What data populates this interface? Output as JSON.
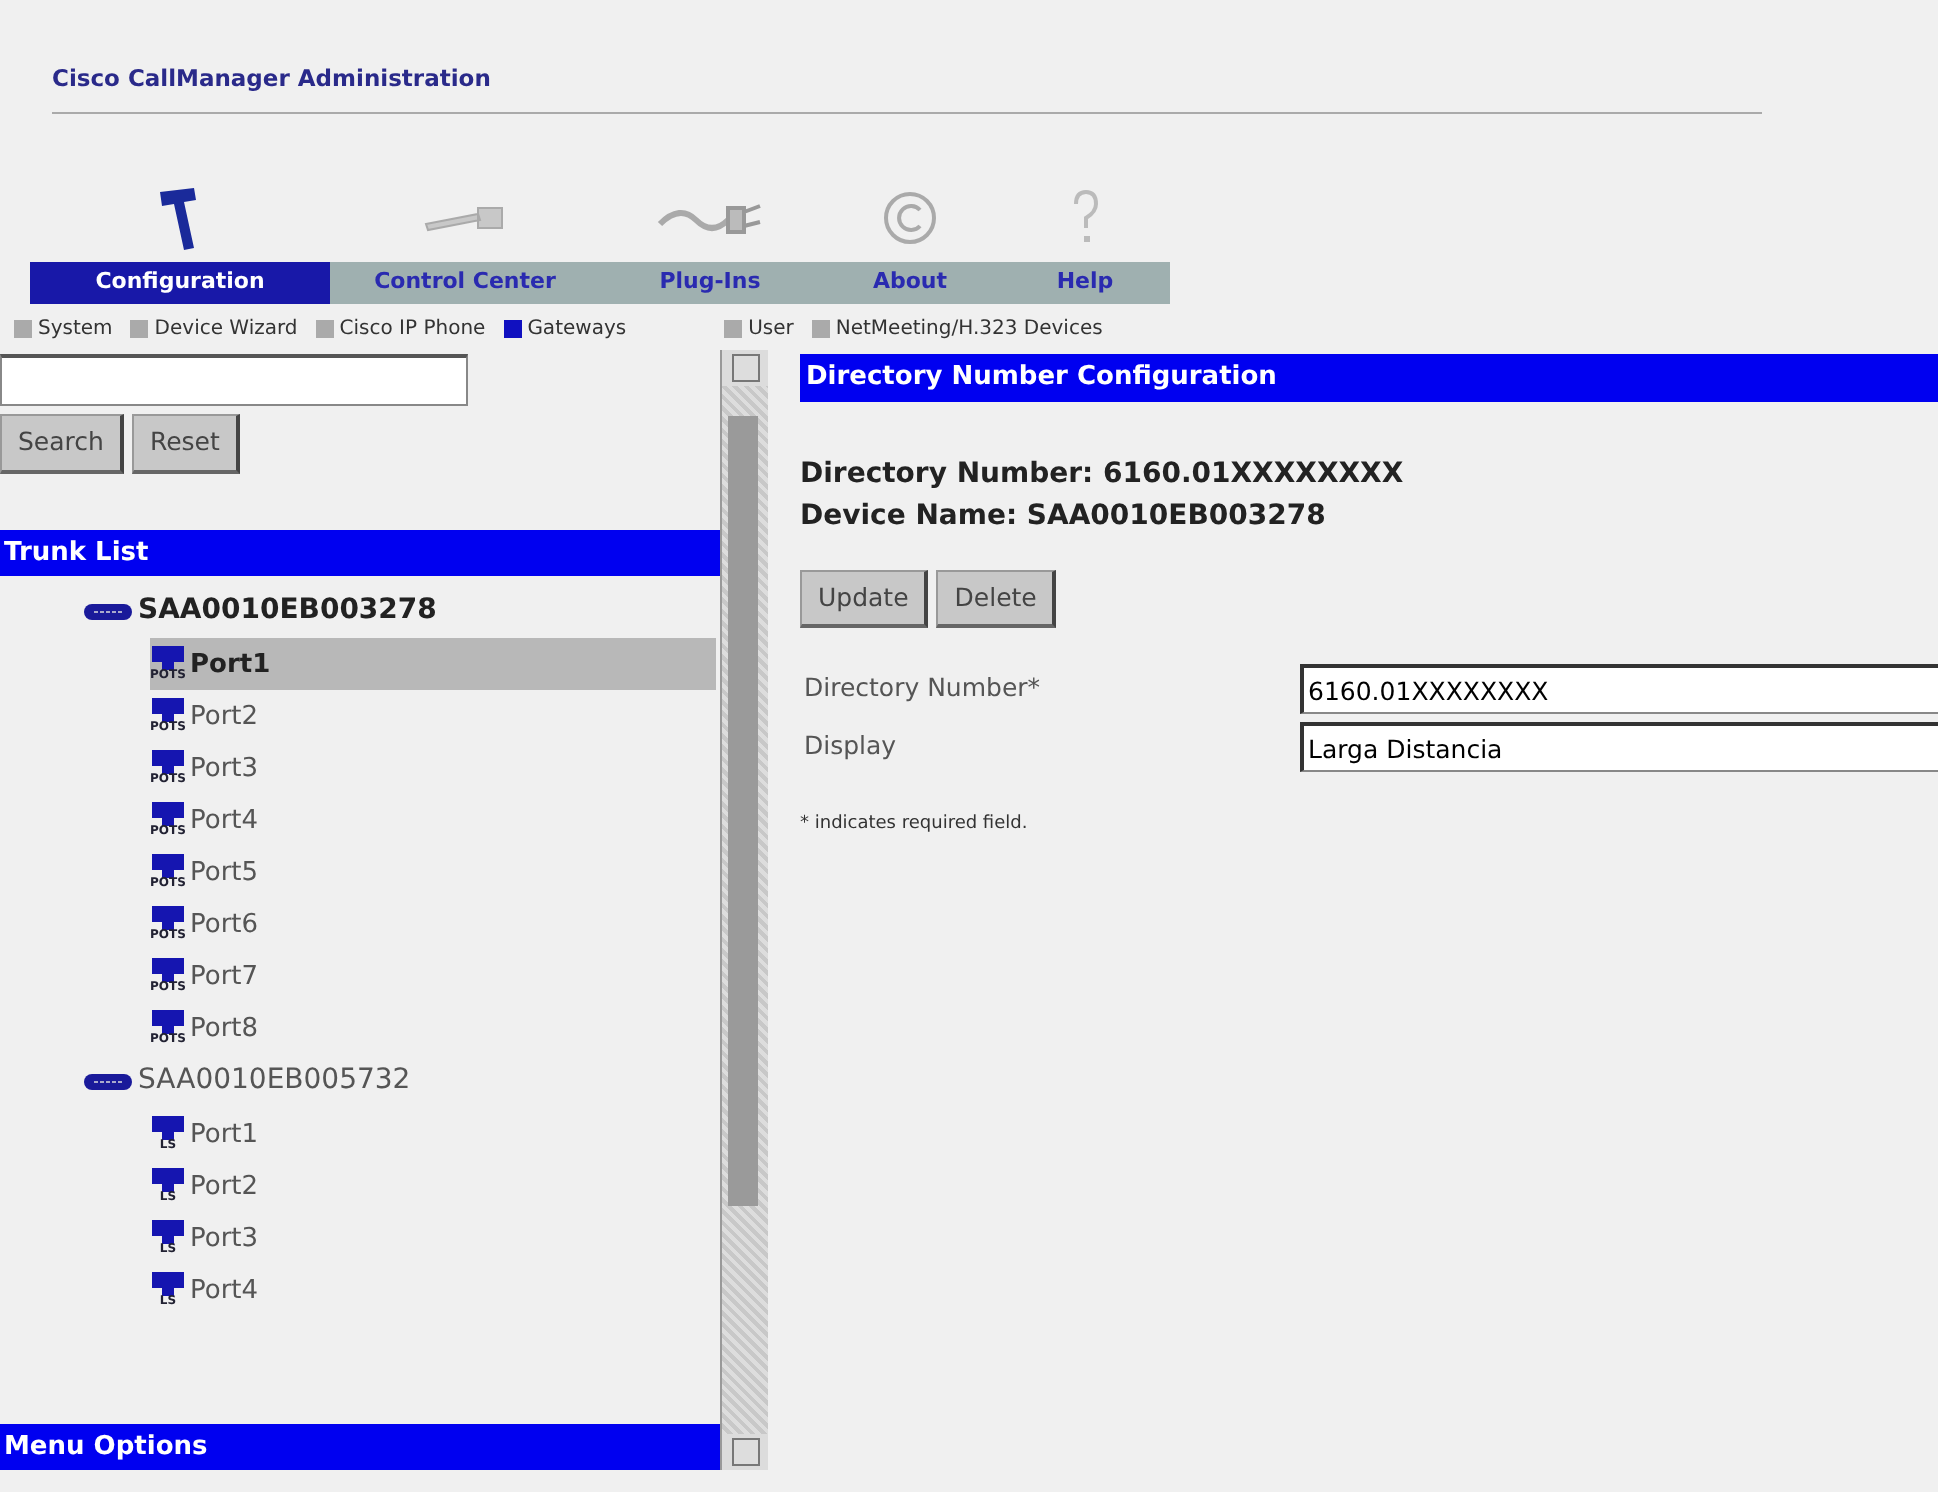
{
  "header": {
    "title": "Cisco CallManager Administration"
  },
  "tabs": [
    {
      "label": "Configuration",
      "selected": true
    },
    {
      "label": "Control Center",
      "selected": false
    },
    {
      "label": "Plug-Ins",
      "selected": false
    },
    {
      "label": "About",
      "selected": false
    },
    {
      "label": "Help",
      "selected": false
    }
  ],
  "submenu": [
    {
      "label": "System",
      "selected": false
    },
    {
      "label": "Device Wizard",
      "selected": false
    },
    {
      "label": "Cisco IP Phone",
      "selected": false
    },
    {
      "label": "Gateways",
      "selected": true
    },
    {
      "label": "User",
      "selected": false
    },
    {
      "label": "NetMeeting/H.323 Devices",
      "selected": false
    }
  ],
  "sidebar": {
    "search_buttons": [
      "Search",
      "Reset"
    ],
    "trunk_list_title": "Trunk List",
    "trunks": [
      {
        "label": "SAA0010EB003278",
        "children": [
          {
            "label": "Port1",
            "icon_label": "POTS",
            "selected": true
          },
          {
            "label": "Port2",
            "icon_label": "POTS",
            "selected": false
          },
          {
            "label": "Port3",
            "icon_label": "POTS",
            "selected": false
          },
          {
            "label": "Port4",
            "icon_label": "POTS",
            "selected": false
          },
          {
            "label": "Port5",
            "icon_label": "POTS",
            "selected": false
          },
          {
            "label": "Port6",
            "icon_label": "POTS",
            "selected": false
          },
          {
            "label": "Port7",
            "icon_label": "POTS",
            "selected": false
          },
          {
            "label": "Port8",
            "icon_label": "POTS",
            "selected": false
          }
        ]
      },
      {
        "label": "SAA0010EB005732",
        "children": [
          {
            "label": "Port1",
            "icon_label": "LS",
            "selected": false
          },
          {
            "label": "Port2",
            "icon_label": "LS",
            "selected": false
          },
          {
            "label": "Port3",
            "icon_label": "LS",
            "selected": false
          },
          {
            "label": "Port4",
            "icon_label": "LS",
            "selected": false
          }
        ]
      }
    ],
    "menu_options_title": "Menu Options"
  },
  "content": {
    "title": "Directory Number Configuration",
    "info": [
      "Directory Number: 6160.01XXXXXXXX",
      "Device Name: SAA0010EB003278"
    ],
    "buttons": [
      "Update",
      "Delete"
    ],
    "fields": [
      {
        "label": "Directory Number*",
        "value": "6160.01XXXXXXXX"
      },
      {
        "label": "Display",
        "value": "Larga Distancia"
      }
    ],
    "note": "* indicates required field."
  }
}
